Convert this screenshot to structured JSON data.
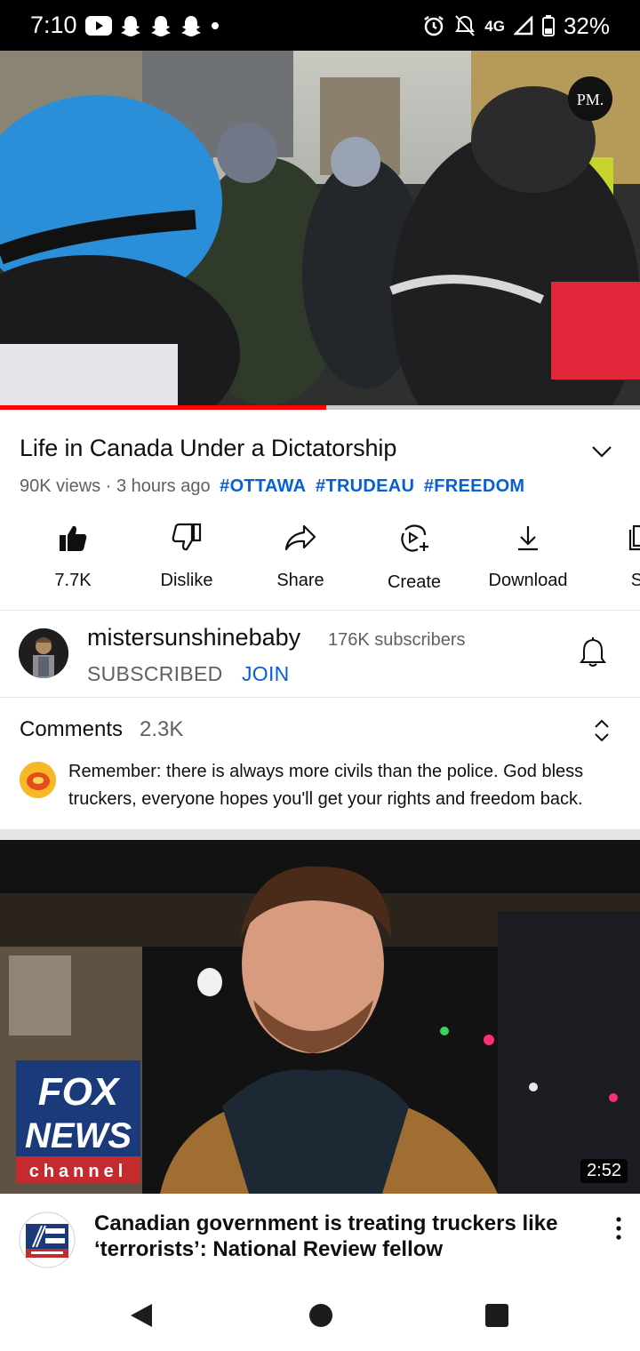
{
  "status_bar": {
    "time": "7:10",
    "network": "4G",
    "battery": "32%"
  },
  "video": {
    "watermark": "PM.",
    "progress_fraction": 0.51
  },
  "details": {
    "title": "Life in Canada Under a Dictatorship",
    "views": "90K views",
    "age": "3 hours ago",
    "hashtags": [
      "#OTTAWA",
      "#TRUDEAU",
      "#FREEDOM"
    ]
  },
  "actions": [
    {
      "label": "7.7K",
      "icon": "thumbs-up-filled-icon"
    },
    {
      "label": "Dislike",
      "icon": "thumbs-down-icon"
    },
    {
      "label": "Share",
      "icon": "share-icon"
    },
    {
      "label": "Create",
      "icon": "create-icon"
    },
    {
      "label": "Download",
      "icon": "download-icon"
    },
    {
      "label": "Sa",
      "icon": "save-icon"
    }
  ],
  "channel": {
    "name": "mistersunshinebaby",
    "subscribers": "176K subscribers",
    "subscribed_label": "SUBSCRIBED",
    "join_label": "JOIN"
  },
  "comments": {
    "title": "Comments",
    "count": "2.3K",
    "top_comment": "Remember: there is always more civils than the police. God bless truckers, everyone hopes you'll get your rights and freedom back."
  },
  "recommended": {
    "duration": "2:52",
    "title": "Canadian government is treating truckers like ‘terrorists’: National Review fellow",
    "logo_text": [
      "FOX",
      "NEWS",
      "channel"
    ]
  },
  "colors": {
    "accent_blue": "#065fd4",
    "progress_red": "#ff0000",
    "fox_red": "#d8262d"
  }
}
